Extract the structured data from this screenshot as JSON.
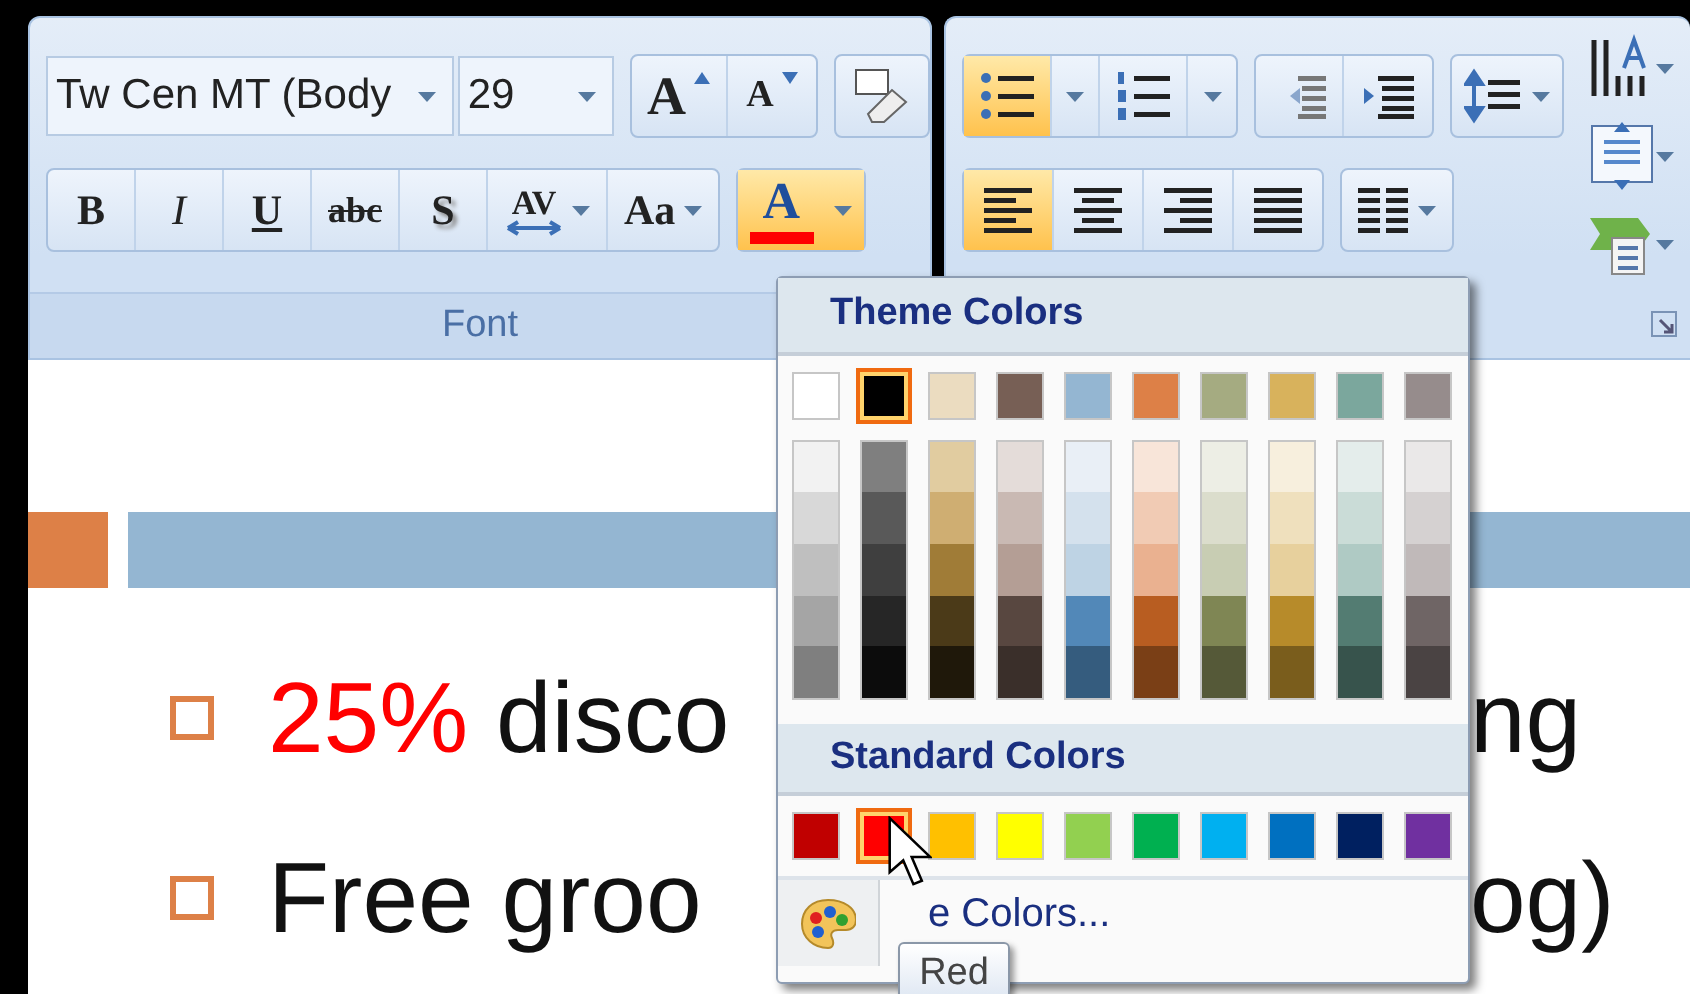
{
  "ribbon": {
    "font_group": {
      "label": "Font",
      "font_name": {
        "value": "Tw Cen MT (Body"
      },
      "font_size": {
        "value": "29"
      },
      "size_buttons": [
        {
          "kind": "grow",
          "label": "A"
        },
        {
          "kind": "shrink",
          "label": "A"
        }
      ],
      "format_buttons": [
        {
          "kind": "bold",
          "label": "B",
          "active": false,
          "dropdown": false
        },
        {
          "kind": "italic",
          "label": "I",
          "active": false,
          "dropdown": false
        },
        {
          "kind": "underline",
          "label": "U",
          "active": false,
          "dropdown": false
        },
        {
          "kind": "strike",
          "label": "abc",
          "active": false,
          "dropdown": false
        },
        {
          "kind": "shadow",
          "label": "S",
          "active": false,
          "dropdown": false
        },
        {
          "kind": "spacing",
          "label": "AV",
          "active": false,
          "dropdown": true
        },
        {
          "kind": "case",
          "label": "Aa",
          "active": false,
          "dropdown": true
        }
      ],
      "font_color": {
        "label": "A",
        "color": "#ff0000",
        "open": true
      }
    },
    "paragraph_group": {
      "list_buttons": [
        {
          "kind": "bullets",
          "active": true
        },
        {
          "kind": "numbering",
          "active": false
        }
      ],
      "indent_buttons": [
        {
          "kind": "decrease"
        },
        {
          "kind": "increase"
        }
      ],
      "align_buttons": [
        {
          "kind": "left",
          "active": true
        },
        {
          "kind": "center",
          "active": false
        },
        {
          "kind": "right",
          "active": false
        },
        {
          "kind": "justify",
          "active": false
        }
      ]
    }
  },
  "slide": {
    "bullets": [
      {
        "parts": [
          {
            "text": "25%",
            "color": "#ff0000"
          },
          {
            "text": " disco"
          }
        ],
        "tail": "ng"
      },
      {
        "parts": [
          {
            "text": "Free groo"
          }
        ],
        "tail": "og)"
      }
    ]
  },
  "color_menu": {
    "theme_title": "Theme Colors",
    "theme_colors": [
      {
        "color": "#ffffff",
        "selected": false
      },
      {
        "color": "#000000",
        "selected": true
      },
      {
        "color": "#ebdcc0",
        "selected": false
      },
      {
        "color": "#775f55",
        "selected": false
      },
      {
        "color": "#94b6d2",
        "selected": false
      },
      {
        "color": "#dd8047",
        "selected": false
      },
      {
        "color": "#a5ab81",
        "selected": false
      },
      {
        "color": "#d8b25c",
        "selected": false
      },
      {
        "color": "#7ba79d",
        "selected": false
      },
      {
        "color": "#968c8c",
        "selected": false
      }
    ],
    "theme_shades": [
      {
        "shades": [
          {
            "color": "#f2f2f2"
          },
          {
            "color": "#d8d8d8"
          },
          {
            "color": "#bfbfbf"
          },
          {
            "color": "#a5a5a5"
          },
          {
            "color": "#7f7f7f"
          }
        ]
      },
      {
        "shades": [
          {
            "color": "#7f7f7f"
          },
          {
            "color": "#595959"
          },
          {
            "color": "#3f3f3f"
          },
          {
            "color": "#262626"
          },
          {
            "color": "#0c0c0c"
          }
        ]
      },
      {
        "shades": [
          {
            "color": "#e1cca0"
          },
          {
            "color": "#cfae72"
          },
          {
            "color": "#a07c37"
          },
          {
            "color": "#4b3a18"
          },
          {
            "color": "#1f180a"
          }
        ]
      },
      {
        "shades": [
          {
            "color": "#e4dcd9"
          },
          {
            "color": "#c9b9b3"
          },
          {
            "color": "#b49e95"
          },
          {
            "color": "#584740"
          },
          {
            "color": "#3a2f2a"
          }
        ]
      },
      {
        "shades": [
          {
            "color": "#e9eff6"
          },
          {
            "color": "#d4e1ed"
          },
          {
            "color": "#bed3e4"
          },
          {
            "color": "#5288b8"
          },
          {
            "color": "#355c7e"
          }
        ]
      },
      {
        "shades": [
          {
            "color": "#f8e5d9"
          },
          {
            "color": "#f1cbb4"
          },
          {
            "color": "#eab190"
          },
          {
            "color": "#b85d21"
          },
          {
            "color": "#7a3f16"
          }
        ]
      },
      {
        "shades": [
          {
            "color": "#edeee5"
          },
          {
            "color": "#dbddcc"
          },
          {
            "color": "#c8cdb3"
          },
          {
            "color": "#7f8654"
          },
          {
            "color": "#555938"
          }
        ]
      },
      {
        "shades": [
          {
            "color": "#f7efdd"
          },
          {
            "color": "#efe0bd"
          },
          {
            "color": "#e7d09d"
          },
          {
            "color": "#b78b2a"
          },
          {
            "color": "#7a5d1c"
          }
        ]
      },
      {
        "shades": [
          {
            "color": "#e4edeb"
          },
          {
            "color": "#cadcd7"
          },
          {
            "color": "#afcac4"
          },
          {
            "color": "#537c72"
          },
          {
            "color": "#37534c"
          }
        ]
      },
      {
        "shades": [
          {
            "color": "#eae8e8"
          },
          {
            "color": "#d5d1d1"
          },
          {
            "color": "#c0b9b9"
          },
          {
            "color": "#6f6565"
          },
          {
            "color": "#4a4343"
          }
        ]
      }
    ],
    "standard_title": "Standard Colors",
    "standard_colors": [
      {
        "color": "#c00000",
        "hovered": false
      },
      {
        "color": "#ff0000",
        "hovered": true
      },
      {
        "color": "#ffc000",
        "hovered": false
      },
      {
        "color": "#ffff00",
        "hovered": false
      },
      {
        "color": "#92d050",
        "hovered": false
      },
      {
        "color": "#00b050",
        "hovered": false
      },
      {
        "color": "#00b0f0",
        "hovered": false
      },
      {
        "color": "#0070c0",
        "hovered": false
      },
      {
        "color": "#002060",
        "hovered": false
      },
      {
        "color": "#7030a0",
        "hovered": false
      }
    ],
    "more_colors": "e Colors..."
  },
  "tooltip": {
    "text": "Red"
  }
}
